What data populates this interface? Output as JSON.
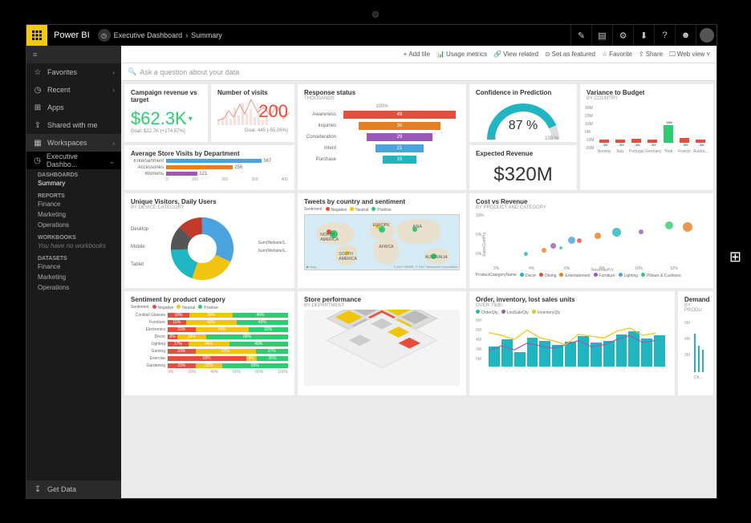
{
  "app": {
    "name": "Power BI"
  },
  "breadcrumb": {
    "workspace": "Executive Dashboard",
    "page": "Summary"
  },
  "sidebar": {
    "favorites": "Favorites",
    "recent": "Recent",
    "apps": "Apps",
    "shared": "Shared with me",
    "workspaces": "Workspaces",
    "current_ws": "Executive Dashbo...",
    "sections": [
      {
        "header": "DASHBOARDS",
        "items": [
          "Summary"
        ]
      },
      {
        "header": "REPORTS",
        "items": [
          "Finance",
          "Marketing",
          "Operations"
        ]
      },
      {
        "header": "WORKBOOKS",
        "items": [
          "You have no workbooks"
        ]
      },
      {
        "header": "DATASETS",
        "items": [
          "Finance",
          "Marketing",
          "Operations"
        ]
      }
    ],
    "getdata": "Get Data"
  },
  "cmdbar": {
    "add_tile": "Add tile",
    "usage": "Usage metrics",
    "related": "View related",
    "featured": "Set as featured",
    "favorite": "Favorite",
    "share": "Share",
    "webview": "Web view"
  },
  "qna": {
    "placeholder": "Ask a question about your data"
  },
  "tiles": {
    "campaign": {
      "title": "Campaign revenue vs target",
      "value": "$62.3K",
      "goal": "Goal: $22.7K (+174.57%)",
      "color": "#2ecc71"
    },
    "visits": {
      "title": "Number of visits",
      "value": "200",
      "goal": "Goal: 445 (-55.06%)",
      "color": "#e74c3c"
    },
    "response": {
      "title": "Response status",
      "sub": "THOUSANDS"
    },
    "confidence": {
      "title": "Confidence in Prediction",
      "value": "87 %",
      "min": "0 %",
      "max": "100 %"
    },
    "variance": {
      "title": "Variance to Budget",
      "sub": "BY COUNTRY"
    },
    "avgstore": {
      "title": "Average Store Visits by Department"
    },
    "expected": {
      "title": "Expected Revenue",
      "value": "$320M"
    },
    "unique": {
      "title": "Unique Visitors, Daily Users",
      "sub": "BY DEVICE CATEGORY"
    },
    "tweets": {
      "title": "Tweets by country and sentiment"
    },
    "costrev": {
      "title": "Cost vs Revenue",
      "sub": "BY PRODUCT AND CATEGORY"
    },
    "sentiment": {
      "title": "Sentiment by product category"
    },
    "store": {
      "title": "Store performance",
      "sub": "BY DEPARTMENT"
    },
    "order": {
      "title": "Order, inventory, lost sales units",
      "sub": "OVER TIME"
    },
    "demand": {
      "title": "Demand",
      "sub": "BY PRODU"
    }
  },
  "chart_data": {
    "response_funnel": {
      "type": "bar",
      "orientation": "horizontal-centered",
      "max_label": "100%",
      "categories": [
        "Awareness",
        "Inquiries",
        "Consideration",
        "Intent",
        "Purchase"
      ],
      "values": [
        49,
        36,
        29,
        21,
        15
      ],
      "colors": [
        "#e74c3c",
        "#e67e22",
        "#9b59b6",
        "#4aa3df",
        "#1fb6c1"
      ]
    },
    "avg_store": {
      "type": "bar",
      "orientation": "horizontal",
      "categories": [
        "Entertainment",
        "Accessories",
        "Womens"
      ],
      "values": [
        367,
        256,
        121
      ],
      "colors": [
        "#4aa3df",
        "#e67e22",
        "#9b59b6"
      ],
      "xticks": [
        0,
        100,
        200,
        300,
        400
      ]
    },
    "variance_waterfall": {
      "type": "bar",
      "ylim": [
        -20,
        30
      ],
      "yticks": [
        "30M",
        "20M",
        "10M",
        "0M",
        "-10M",
        "-20M"
      ],
      "categories": [
        "Norway",
        "Italy",
        "Portugal",
        "Germany",
        "Total",
        "France",
        "Austra..."
      ],
      "values": [
        -3,
        -3,
        -4,
        -3,
        18,
        -5,
        -3
      ],
      "colors": [
        "#e74c3c",
        "#e74c3c",
        "#e74c3c",
        "#e74c3c",
        "#2ecc71",
        "#e74c3c",
        "#e74c3c"
      ]
    },
    "sentiment_stacked": {
      "type": "bar",
      "stacked": true,
      "categories": [
        "Cocktail Glasses",
        "Furniture",
        "Electronics",
        "Décor",
        "Lighting",
        "Gaming",
        "Exercise",
        "Gardening"
      ],
      "legend": [
        "Negative",
        "Neutral",
        "Positive"
      ],
      "legend_colors": [
        "#e74c3c",
        "#f1c40f",
        "#2ecc71"
      ],
      "series": [
        {
          "name": "Negative",
          "values": [
            18,
            15,
            23,
            8,
            17,
            23,
            65,
            23
          ]
        },
        {
          "name": "Neutral",
          "values": [
            36,
            42,
            44,
            24,
            34,
            50,
            9,
            22
          ]
        },
        {
          "name": "Positive",
          "values": [
            46,
            43,
            33,
            68,
            49,
            27,
            26,
            55
          ]
        }
      ],
      "xticks": [
        0,
        20,
        40,
        60,
        80,
        100
      ],
      "xsuffix": "%"
    },
    "confidence_gauge": {
      "type": "gauge",
      "value": 87,
      "min": 0,
      "max": 100
    },
    "cost_vs_revenue": {
      "type": "scatter",
      "xlabel": "RevenuePct",
      "ylabel": "SalesCostPct",
      "xticks": [
        "2%",
        "4%",
        "6%",
        "8%",
        "10%",
        "12%"
      ],
      "yticks": [
        "10%",
        "5%",
        "0%"
      ],
      "legend": [
        "Decor",
        "Dining",
        "Entertainment",
        "Furniture",
        "Lighting",
        "Pillows & Cushions"
      ],
      "legend_colors": [
        "#1fb6c1",
        "#e74c3c",
        "#e67e22",
        "#9b59b6",
        "#4aa3df",
        "#2ecc71"
      ],
      "points": [
        {
          "x": 2,
          "y": 1.5,
          "r": 5,
          "c": "#1fb6c1"
        },
        {
          "x": 3,
          "y": 2.2,
          "r": 6,
          "c": "#e67e22"
        },
        {
          "x": 3.5,
          "y": 3,
          "r": 7,
          "c": "#9b59b6"
        },
        {
          "x": 4,
          "y": 2.8,
          "r": 4,
          "c": "#2ecc71"
        },
        {
          "x": 4.5,
          "y": 4,
          "r": 9,
          "c": "#4aa3df"
        },
        {
          "x": 5,
          "y": 4.2,
          "r": 6,
          "c": "#e74c3c"
        },
        {
          "x": 6,
          "y": 5,
          "r": 8,
          "c": "#e67e22"
        },
        {
          "x": 7,
          "y": 5.5,
          "r": 11,
          "c": "#1fb6c1"
        },
        {
          "x": 8.5,
          "y": 6,
          "r": 6,
          "c": "#9b59b6"
        },
        {
          "x": 10,
          "y": 7,
          "r": 10,
          "c": "#2ecc71"
        },
        {
          "x": 11,
          "y": 6.5,
          "r": 12,
          "c": "#e67e22"
        }
      ]
    },
    "order_inventory": {
      "type": "bar+line",
      "yticks": [
        "8M",
        "6M",
        "4M",
        "2M",
        "0M"
      ],
      "legend": [
        "OrderQty",
        "LostSaleQty",
        "InventoryQty"
      ],
      "legend_colors": [
        "#1fb6c1",
        "#9b59b6",
        "#f1c40f"
      ],
      "bars": [
        3.8,
        5.2,
        2.8,
        5.5,
        5.0,
        4.2,
        4.8,
        5.8,
        4.6,
        5.0,
        6.2,
        6.8,
        5.4,
        6.0
      ],
      "line1": [
        3,
        4,
        3.2,
        4.5,
        4,
        3.5,
        4.2,
        5,
        3.8,
        4.2,
        5.2,
        6,
        4.6,
        5
      ],
      "line2": [
        6.5,
        6,
        5.2,
        7,
        5.5,
        5,
        4.2,
        6.2,
        5.8,
        5.5,
        6.8,
        7.4,
        6,
        6.4
      ]
    },
    "unique_visitors": {
      "type": "pie",
      "categories": [
        "Desktop",
        "Mobile",
        "Tablet"
      ],
      "legend": [
        "Sum(WebsiteS...",
        "Sum(WebsiteS..."
      ],
      "values": [
        45,
        35,
        20
      ]
    },
    "tweets_map": {
      "type": "map",
      "legend": [
        "Negative",
        "Neutral",
        "Positive"
      ],
      "legend_colors": [
        "#e74c3c",
        "#f1c40f",
        "#2ecc71"
      ],
      "regions": [
        "NORTH AMERICA",
        "EUROPE",
        "ASIA",
        "SOUTH AMERICA",
        "AFRICA",
        "AUSTRALIA"
      ],
      "attribution": "© 2017 HERE, © 2017 Microsoft Corporation"
    },
    "demand": {
      "type": "bar",
      "yticks": [
        "6M",
        "4M",
        "2M"
      ],
      "values": [
        5.5,
        3.8,
        3.2
      ],
      "color": "#1fb6c1",
      "categories": [
        "Ch...",
        "",
        "..."
      ]
    }
  }
}
